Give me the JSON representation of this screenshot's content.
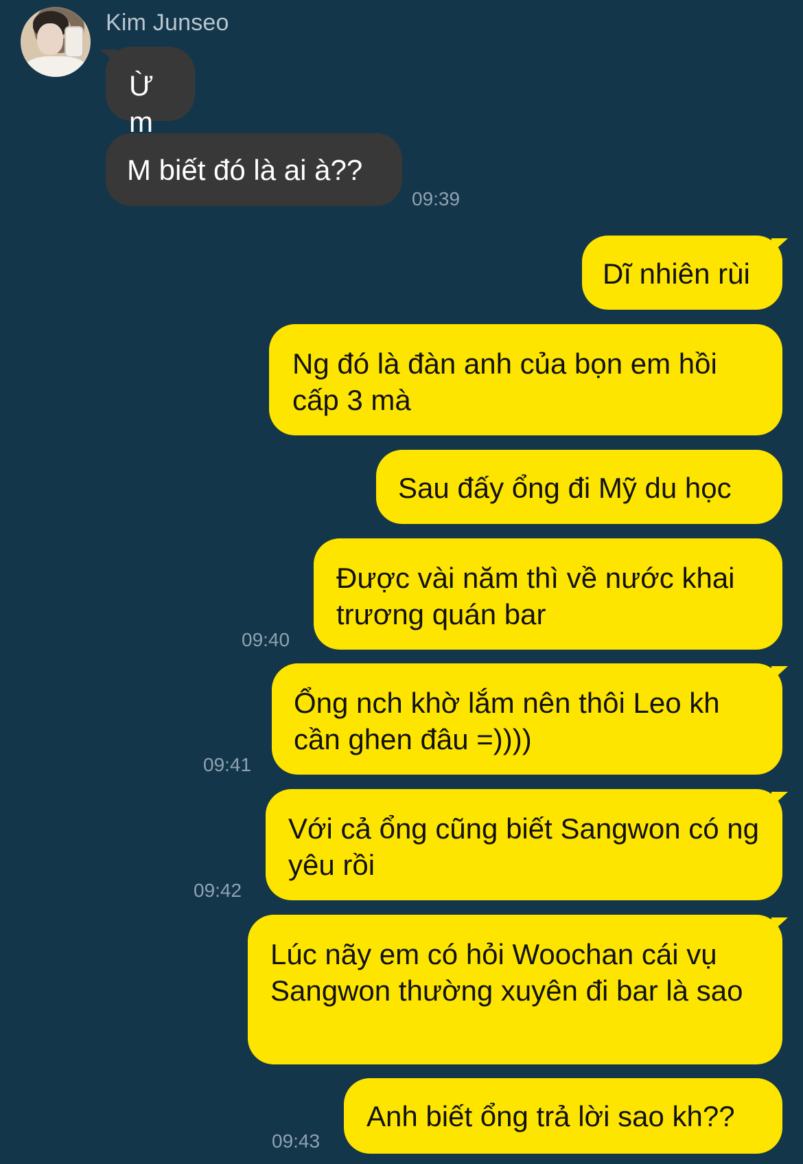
{
  "chat": {
    "sender_name": "Kim Junseo",
    "avatar_icon": "profile-photo",
    "messages": [
      {
        "side": "incoming",
        "text": "Ừm"
      },
      {
        "side": "incoming",
        "text": "M biết đó là ai à??",
        "time": "09:39"
      },
      {
        "side": "outgoing",
        "text": "Dĩ nhiên rùi"
      },
      {
        "side": "outgoing",
        "text": "Ng đó là đàn anh của bọn em hồi cấp 3 mà"
      },
      {
        "side": "outgoing",
        "text": "Sau đấy ổng đi Mỹ du học"
      },
      {
        "side": "outgoing",
        "text": "Được vài năm thì về nước khai trương quán bar",
        "time": "09:40"
      },
      {
        "side": "outgoing",
        "text": "Ổng nch khờ lắm nên thôi Leo kh cần ghen đâu =))))",
        "time": "09:41"
      },
      {
        "side": "outgoing",
        "text": "Với cả ổng cũng biết Sangwon có ng yêu rồi",
        "time": "09:42"
      },
      {
        "side": "outgoing",
        "text": "Lúc nãy em có hỏi Woochan cái vụ Sangwon thường xuyên đi bar là sao"
      },
      {
        "side": "outgoing",
        "text": "Anh biết ổng trả lời sao kh??",
        "time": "09:43"
      }
    ]
  },
  "colors": {
    "background": "#14364a",
    "incoming_bubble": "#383839",
    "outgoing_bubble": "#fee500",
    "timestamp": "#8fa2b1",
    "sender_name": "#b8c5ce"
  }
}
